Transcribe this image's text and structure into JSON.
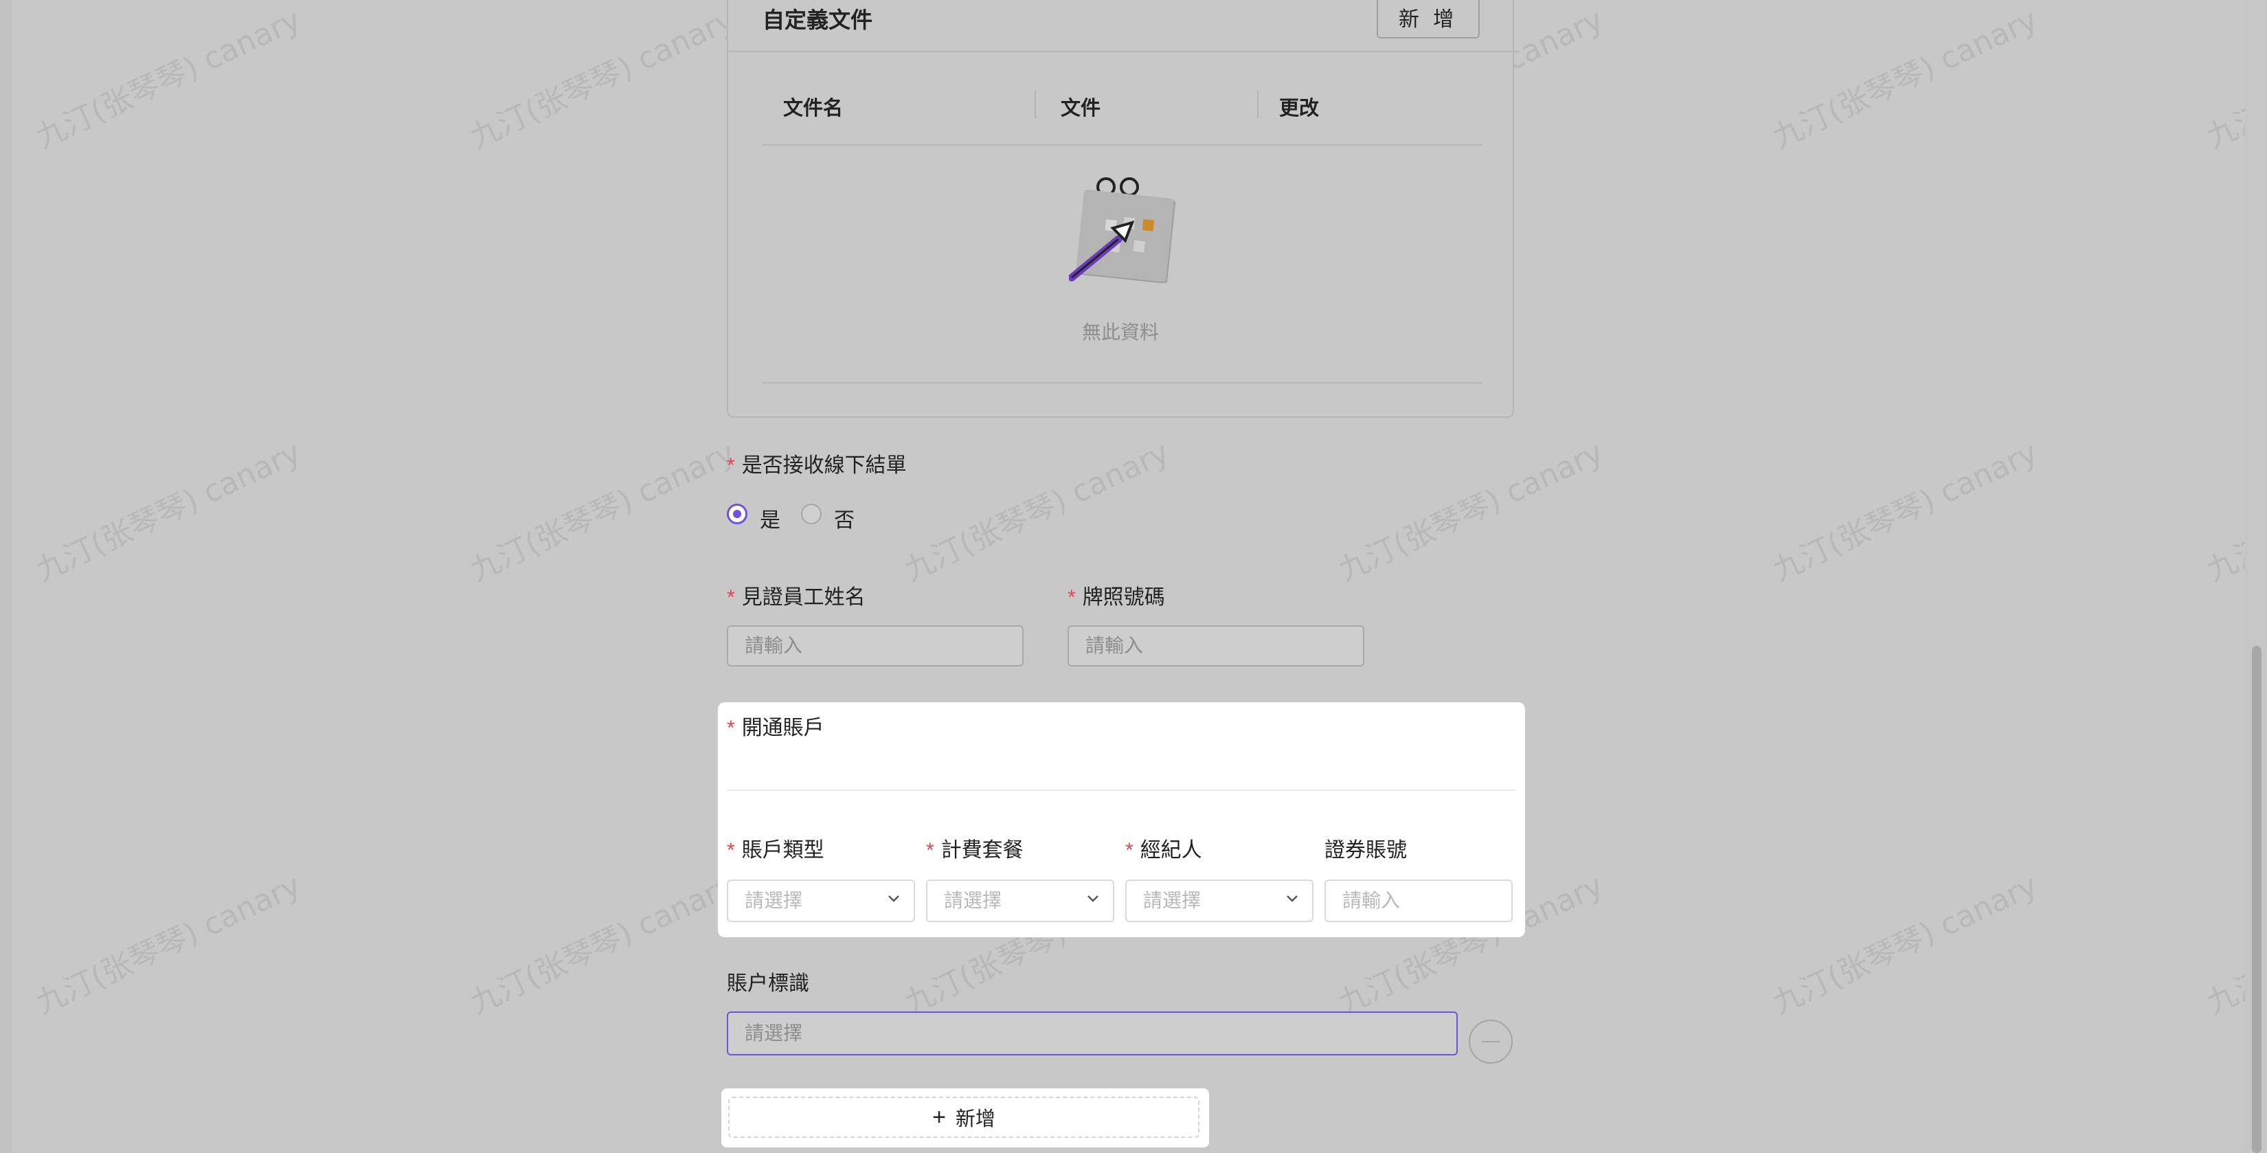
{
  "watermark_text": "九汀(张琴琴) canary",
  "custom_docs": {
    "title": "自定義文件",
    "add_button": "新 增",
    "columns": [
      "文件名",
      "文件",
      "更改"
    ],
    "empty_text": "無此資料"
  },
  "offline_settlement": {
    "label": "是否接收線下結單",
    "options": [
      {
        "label": "是",
        "selected": true
      },
      {
        "label": "否",
        "selected": false
      }
    ]
  },
  "witness_name": {
    "label": "見證員工姓名",
    "placeholder": "請輸入"
  },
  "license_no": {
    "label": "牌照號碼",
    "placeholder": "請輸入"
  },
  "open_account": {
    "label": "開通賬戶",
    "fields": [
      {
        "label": "賬戶類型",
        "required": true,
        "placeholder": "請選擇",
        "type": "select"
      },
      {
        "label": "計費套餐",
        "required": true,
        "placeholder": "請選擇",
        "type": "select"
      },
      {
        "label": "經紀人",
        "required": true,
        "placeholder": "請選擇",
        "type": "select"
      },
      {
        "label": "證券賬號",
        "required": false,
        "placeholder": "請輸入",
        "type": "input"
      }
    ]
  },
  "account_tag": {
    "label": "賬户標識",
    "placeholder": "請選擇"
  },
  "add_new": {
    "label": "新增"
  },
  "colors": {
    "accent": "#6a55d8",
    "required": "#e0454a"
  }
}
